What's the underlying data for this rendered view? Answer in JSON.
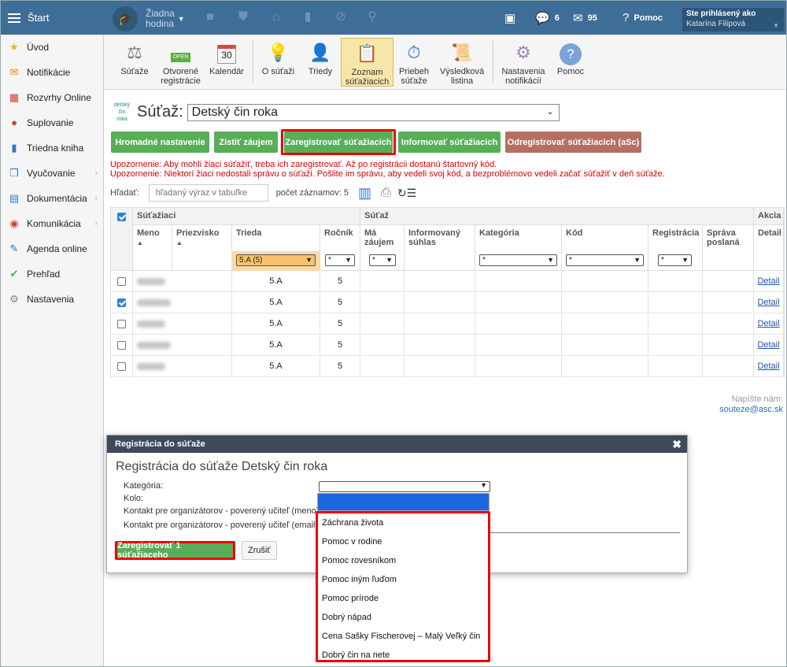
{
  "topbar": {
    "start_label": "Štart",
    "lesson_label": "Žiadna\nhodina",
    "messages_count": "6",
    "mail_count": "95",
    "help_label": "Pomoc",
    "logged_as_label": "Ste prihlásený ako",
    "user_name": "Katarína Filipová"
  },
  "sidebar": {
    "items": [
      {
        "label": "Úvod",
        "icon": "star-icon",
        "color": "#f0b400"
      },
      {
        "label": "Notifikácie",
        "icon": "envelope-icon",
        "color": "#f08a00"
      },
      {
        "label": "Rozvrhy Online",
        "icon": "timetable-icon",
        "color": "#d0402a"
      },
      {
        "label": "Suplovanie",
        "icon": "substitution-icon",
        "color": "#d0402a"
      },
      {
        "label": "Triedna kniha",
        "icon": "book-icon",
        "color": "#2c79c7"
      },
      {
        "label": "Vyučovanie",
        "icon": "open-book-icon",
        "color": "#2c79c7"
      },
      {
        "label": "Dokumentácia",
        "icon": "document-icon",
        "color": "#2c79c7"
      },
      {
        "label": "Komunikácia",
        "icon": "chat-icon",
        "color": "#d0402a"
      },
      {
        "label": "Agenda online",
        "icon": "pen-icon",
        "color": "#2c79c7"
      },
      {
        "label": "Prehľad",
        "icon": "check-circle-icon",
        "color": "#3ab54a"
      },
      {
        "label": "Nastavenia",
        "icon": "gear-icon",
        "color": "#888888"
      }
    ]
  },
  "modules": [
    {
      "label": "Súťaže",
      "icon": "scales-icon"
    },
    {
      "label": "Otvorené\nregistrácie",
      "icon": "open-sign-icon"
    },
    {
      "label": "Kalendár",
      "icon": "calendar-icon",
      "badge": "30"
    },
    {
      "label": "O súťaži",
      "icon": "bulb-icon"
    },
    {
      "label": "Triedy",
      "icon": "student-icon"
    },
    {
      "label": "Zoznam\nsúťažiacich",
      "icon": "clipboard-icon"
    },
    {
      "label": "Priebeh\nsúťaže",
      "icon": "stopwatch-icon"
    },
    {
      "label": "Výsledková\nlistina",
      "icon": "results-icon"
    },
    {
      "label": "Nastavenia\nnotifikácií",
      "icon": "gear-icon"
    },
    {
      "label": "Pomoc",
      "icon": "help-icon"
    }
  ],
  "competition": {
    "logo_text": "detský\nčin\nroka",
    "label": "Súťaž:",
    "selected": "Detský čin roka"
  },
  "actions": {
    "bulk": "Hromadné nastavenie",
    "interest": "Zistiť záujem",
    "register": "Zaregistrovať súťažiacich",
    "inform": "Informovať súťažiacich",
    "unregister": "Odregistrovať súťažiacich (aSc)"
  },
  "warnings": [
    "Upozornenie: Aby mohli žiaci súťažiť, treba ich zaregistrovať. Až po registrácii dostanú štartovný kód.",
    "Upozornenie: Niektorí žiaci nedostali správu o súťaži. Pošlite im správu, aby vedeli svoj kód, a bezproblémovo vedeli začať súťažiť v deň súťaže."
  ],
  "search": {
    "label": "Hľadať:",
    "placeholder": "hľadaný výraz v tabuľke",
    "count_label": "počet záznamov: 5"
  },
  "table": {
    "group_students": "Súťažiaci",
    "group_competition": "Súťaž",
    "group_action": "Akcia",
    "columns": {
      "meno": "Meno",
      "priezvisko": "Priezvisko",
      "trieda": "Trieda",
      "rocnik": "Ročník",
      "ma_zaujem": "Má\nzáujem",
      "suhlas": "Informovaný\nsúhlas",
      "kategoria": "Kategória",
      "kod": "Kód",
      "registracia": "Registrácia",
      "sprava": "Správa\nposlaná",
      "detail": "Detail"
    },
    "filters": {
      "trieda": "5.A (5)",
      "any": "*"
    },
    "rows": [
      {
        "checked": false,
        "trieda": "5.A",
        "rocnik": "5",
        "detail": "Detail"
      },
      {
        "checked": true,
        "trieda": "5.A",
        "rocnik": "5",
        "detail": "Detail"
      },
      {
        "checked": false,
        "trieda": "5.A",
        "rocnik": "5",
        "detail": "Detail"
      },
      {
        "checked": false,
        "trieda": "5.A",
        "rocnik": "5",
        "detail": "Detail"
      },
      {
        "checked": false,
        "trieda": "5.A",
        "rocnik": "5",
        "detail": "Detail"
      }
    ]
  },
  "help": {
    "line1": "Napíšte nám:",
    "email": "souteze@asc.sk"
  },
  "dialog": {
    "header": "Registrácia do súťaže",
    "title": "Registrácia do súťaže Detský čin roka",
    "labels": {
      "category": "Kategória:",
      "round": "Kolo:",
      "contact_name": "Kontakt pre organizátorov - poverený učiteľ (meno):",
      "contact_email": "Kontakt pre organizátorov - poverený učiteľ (email):"
    },
    "register_button": "Zaregistrovať 1 súťažiaceho",
    "cancel_button": "Zrušiť",
    "category_options": [
      "Záchrana života",
      "Pomoc v rodine",
      "Pomoc rovesníkom",
      "Pomoc iným ľuďom",
      "Pomoc prírode",
      "Dobrý nápad",
      "Cena Sašky Fischerovej – Malý Veľký čin",
      "Dobrý čin na nete"
    ]
  }
}
